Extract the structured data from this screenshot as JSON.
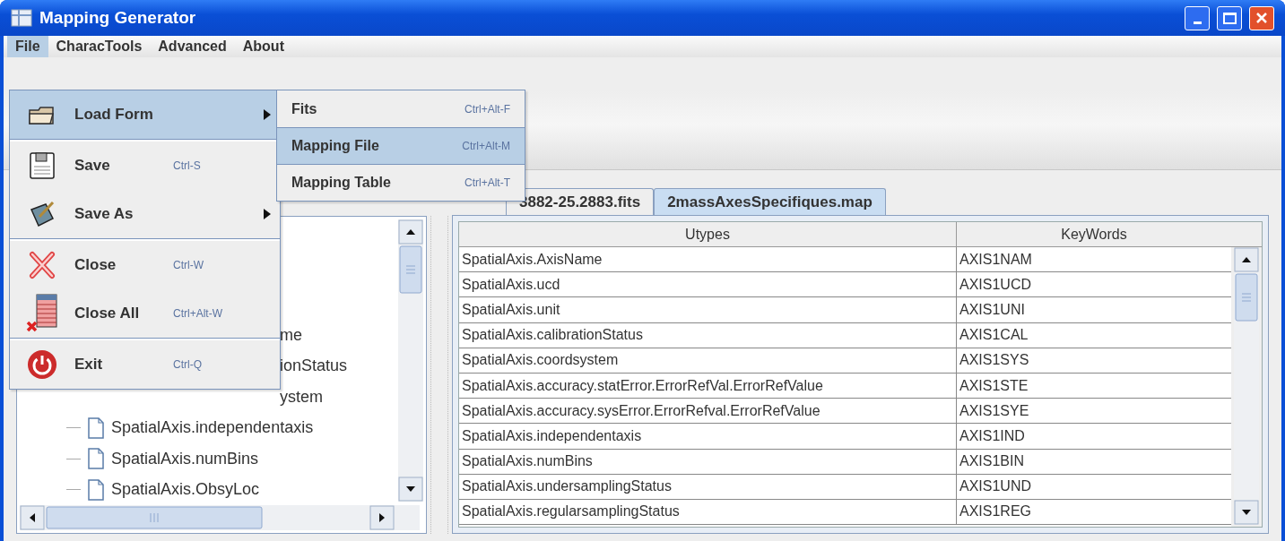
{
  "window": {
    "title": "Mapping Generator"
  },
  "menu_bar": [
    {
      "label": "File",
      "selected": true
    },
    {
      "label": "CharacTools",
      "selected": false
    },
    {
      "label": "Advanced",
      "selected": false
    },
    {
      "label": "About",
      "selected": false
    }
  ],
  "file_menu": [
    {
      "kind": "item",
      "label": "Load Form",
      "submenu": true,
      "selected": true
    },
    {
      "kind": "separator"
    },
    {
      "kind": "item",
      "label": "Save",
      "shortcut": "Ctrl-S",
      "submenu": false,
      "selected": false
    },
    {
      "kind": "item",
      "label": "Save As",
      "submenu": true,
      "selected": false
    },
    {
      "kind": "separator"
    },
    {
      "kind": "item",
      "label": "Close",
      "shortcut": "Ctrl-W",
      "submenu": false,
      "selected": false
    },
    {
      "kind": "item",
      "label": "Close All",
      "shortcut": "Ctrl+Alt-W",
      "submenu": false,
      "selected": false
    },
    {
      "kind": "separator"
    },
    {
      "kind": "item",
      "label": "Exit",
      "shortcut": "Ctrl-Q",
      "submenu": false,
      "selected": false
    }
  ],
  "load_form_submenu": [
    {
      "label": "Fits",
      "shortcut": "Ctrl+Alt-F",
      "selected": false
    },
    {
      "label": "Mapping File",
      "shortcut": "Ctrl+Alt-M",
      "selected": true
    },
    {
      "label": "Mapping Table",
      "shortcut": "Ctrl+Alt-T",
      "selected": false
    }
  ],
  "tree": {
    "partly_hidden_items": [
      "me",
      "ionStatus",
      "ystem"
    ],
    "items": [
      "SpatialAxis.independentaxis",
      "SpatialAxis.numBins",
      "SpatialAxis.ObsyLoc"
    ]
  },
  "tabs": [
    {
      "label": "3882-25.2883.fits",
      "selected": false
    },
    {
      "label": "2massAxesSpecifiques.map",
      "selected": true
    }
  ],
  "table": {
    "columns": [
      "Utypes",
      "KeyWords"
    ],
    "rows": [
      [
        "SpatialAxis.AxisName",
        "AXIS1NAM"
      ],
      [
        "SpatialAxis.ucd",
        "AXIS1UCD"
      ],
      [
        "SpatialAxis.unit",
        "AXIS1UNI"
      ],
      [
        "SpatialAxis.calibrationStatus",
        "AXIS1CAL"
      ],
      [
        "SpatialAxis.coordsystem",
        "AXIS1SYS"
      ],
      [
        "SpatialAxis.accuracy.statError.ErrorRefVal.ErrorRefValue",
        "AXIS1STE"
      ],
      [
        "SpatialAxis.accuracy.sysError.ErrorRefval.ErrorRefValue",
        "AXIS1SYE"
      ],
      [
        "SpatialAxis.independentaxis",
        "AXIS1IND"
      ],
      [
        "SpatialAxis.numBins",
        "AXIS1BIN"
      ],
      [
        "SpatialAxis.undersamplingStatus",
        "AXIS1UND"
      ],
      [
        "SpatialAxis.regularsamplingStatus",
        "AXIS1REG"
      ]
    ]
  }
}
